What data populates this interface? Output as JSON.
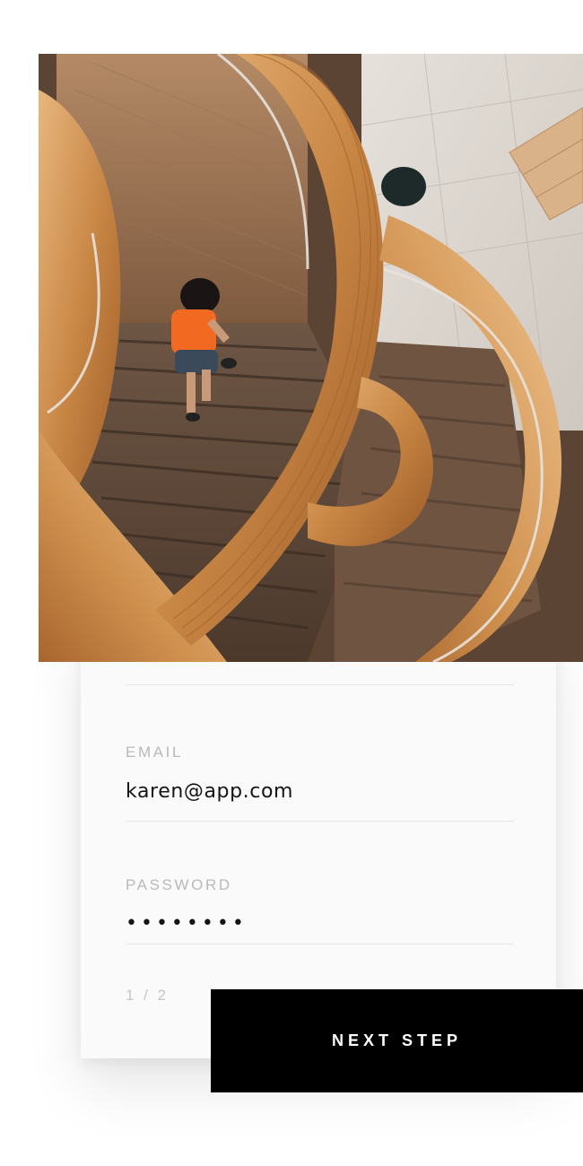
{
  "form": {
    "email_label": "EMAIL",
    "email_value": "karen@app.com",
    "password_label": "PASSWORD",
    "password_value": "••••••••",
    "step_indicator": "1 / 2",
    "next_button_label": "NEXT STEP"
  },
  "hero": {
    "image_subject": "spiral-staircase-photo"
  },
  "colors": {
    "background": "#ffffff",
    "card": "#fafafa",
    "button": "#000000",
    "button_text": "#ffffff",
    "label": "#b9b9b9",
    "value": "#151515"
  }
}
